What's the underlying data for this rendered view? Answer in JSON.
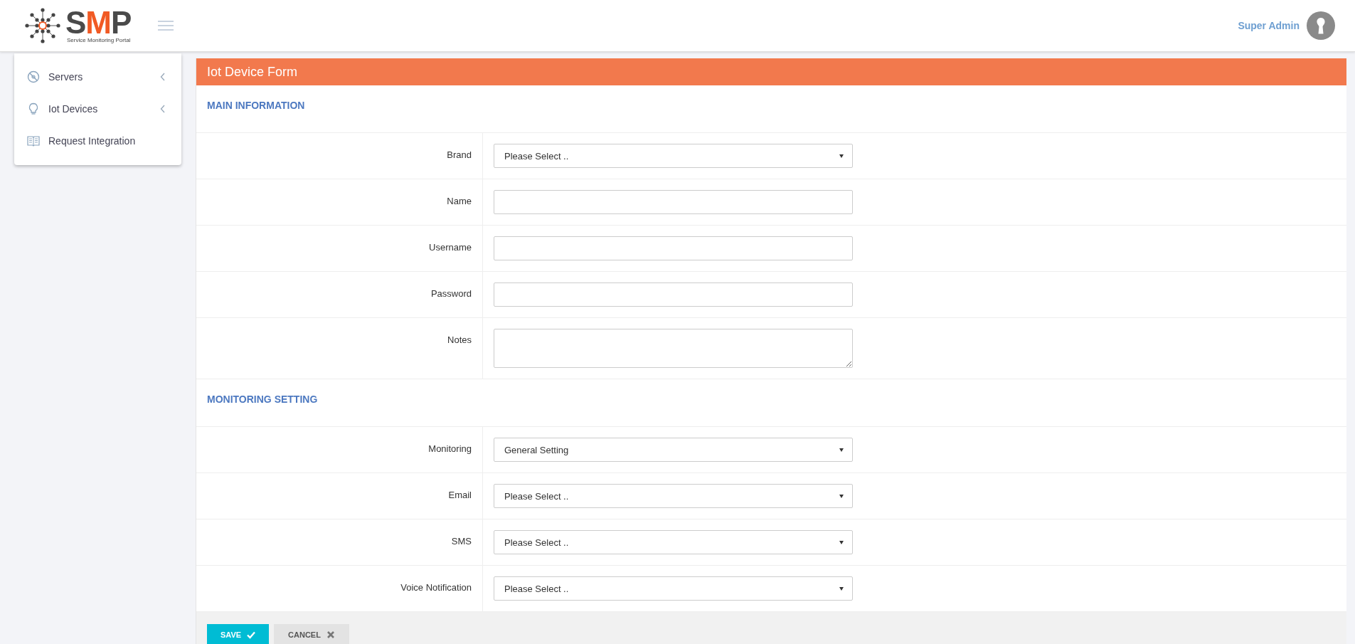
{
  "header": {
    "logo": {
      "letters": [
        {
          "text": "S",
          "color": "#4a4a4a"
        },
        {
          "text": "M",
          "color": "#f15a24"
        },
        {
          "text": "P",
          "color": "#4a4a4a"
        }
      ],
      "subtitle": "Service Monitoring Portal"
    },
    "user": "Super Admin"
  },
  "sidebar": {
    "items": [
      {
        "label": "Servers",
        "kind": "disc",
        "expandable": true
      },
      {
        "label": "Iot Devices",
        "kind": "bulb",
        "expandable": true
      },
      {
        "label": "Request Integration",
        "kind": "book",
        "expandable": false
      }
    ]
  },
  "form": {
    "title": "Iot Device Form",
    "sections": [
      {
        "title": "MAIN INFORMATION",
        "fields": [
          {
            "label": "Brand",
            "kind": "select",
            "value": "Please Select .."
          },
          {
            "label": "Name",
            "kind": "input"
          },
          {
            "label": "Username",
            "kind": "input"
          },
          {
            "label": "Password",
            "kind": "input"
          },
          {
            "label": "Notes",
            "kind": "textarea"
          }
        ]
      },
      {
        "title": "MONITORING SETTING",
        "fields": [
          {
            "label": "Monitoring",
            "kind": "select",
            "value": "General Setting"
          },
          {
            "label": "Email",
            "kind": "select",
            "value": "Please Select .."
          },
          {
            "label": "SMS",
            "kind": "select",
            "value": "Please Select .."
          },
          {
            "label": "Voice Notification",
            "kind": "select",
            "value": "Please Select .."
          }
        ]
      }
    ],
    "buttons": [
      {
        "label": "SAVE",
        "kind": "primary"
      },
      {
        "label": "CANCEL",
        "kind": "secondary"
      }
    ]
  }
}
